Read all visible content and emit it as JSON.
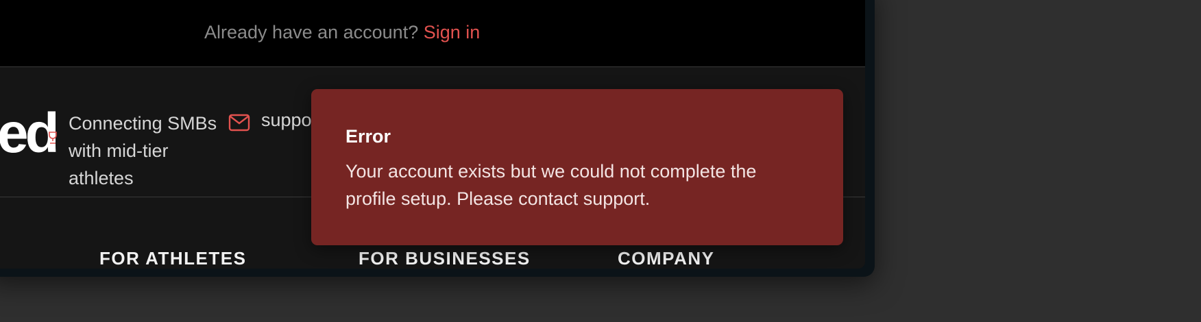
{
  "signin": {
    "prompt": "Already have an account?",
    "link_label": "Sign in"
  },
  "brand": {
    "logo_fragment": "ed",
    "tagline": "Connecting SMBs with mid-tier athletes",
    "support_fragment": "suppo"
  },
  "footer": {
    "nav_headings": [
      "FOR ATHLETES",
      "FOR BUSINESSES",
      "COMPANY"
    ]
  },
  "toast": {
    "title": "Error",
    "message": "Your account exists but we could not complete the profile setup. Please contact support."
  },
  "colors": {
    "accent": "#e2524f",
    "toast_background": "#762523",
    "page_background": "#151515"
  },
  "icons": {
    "mail": "mail-icon",
    "logo_mark": "trophy-icon"
  }
}
